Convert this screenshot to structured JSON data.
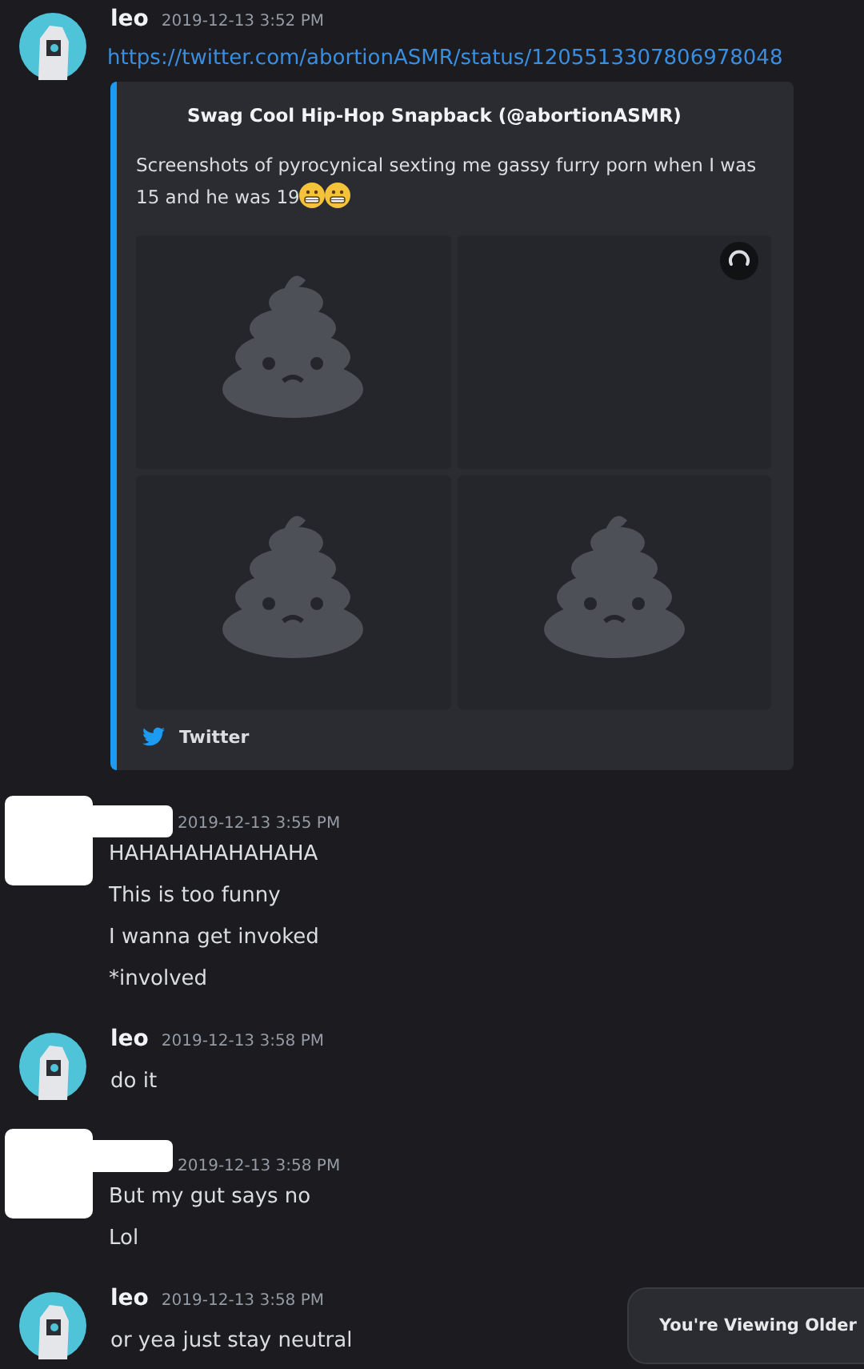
{
  "messages": [
    {
      "redacted": false,
      "author": "leo",
      "timestamp": "2019-12-13 3:52 PM",
      "lines": [
        {
          "kind": "link",
          "text": "https://twitter.com/abortionASMR/status/1205513307806978048"
        }
      ],
      "embed": {
        "title": "Swag Cool Hip-Hop Snapback (@abortionASMR)",
        "description": "Screenshots of pyrocynical sexting me gassy furry porn when I was 15 and he was 19",
        "emojis": [
          {
            "kind": "grimacing"
          },
          {
            "kind": "grimacing"
          }
        ],
        "images": [
          {
            "kind": "picture"
          },
          {
            "kind": "loading"
          },
          {
            "kind": "picture"
          },
          {
            "kind": "picture"
          }
        ],
        "footer": "Twitter"
      }
    },
    {
      "redacted": true,
      "timestamp": "2019-12-13 3:55 PM",
      "lines": [
        {
          "kind": "text",
          "text": "HAHAHAHAHAHAHA"
        },
        {
          "kind": "text",
          "text": "This is too funny"
        },
        {
          "kind": "text",
          "text": "I wanna get invoked"
        },
        {
          "kind": "text",
          "text": "*involved"
        }
      ]
    },
    {
      "redacted": false,
      "author": "leo",
      "timestamp": "2019-12-13 3:58 PM",
      "lines": [
        {
          "kind": "text",
          "text": "do it"
        }
      ]
    },
    {
      "redacted": true,
      "timestamp": "2019-12-13 3:58 PM",
      "lines": [
        {
          "kind": "text",
          "text": "But my gut says no"
        },
        {
          "kind": "text",
          "text": "Lol"
        }
      ]
    },
    {
      "redacted": false,
      "author": "leo",
      "timestamp": "2019-12-13 3:58 PM",
      "lines": [
        {
          "kind": "text",
          "text": "or yea just stay neutral"
        }
      ]
    }
  ],
  "toast": {
    "text": "You're Viewing Older"
  }
}
